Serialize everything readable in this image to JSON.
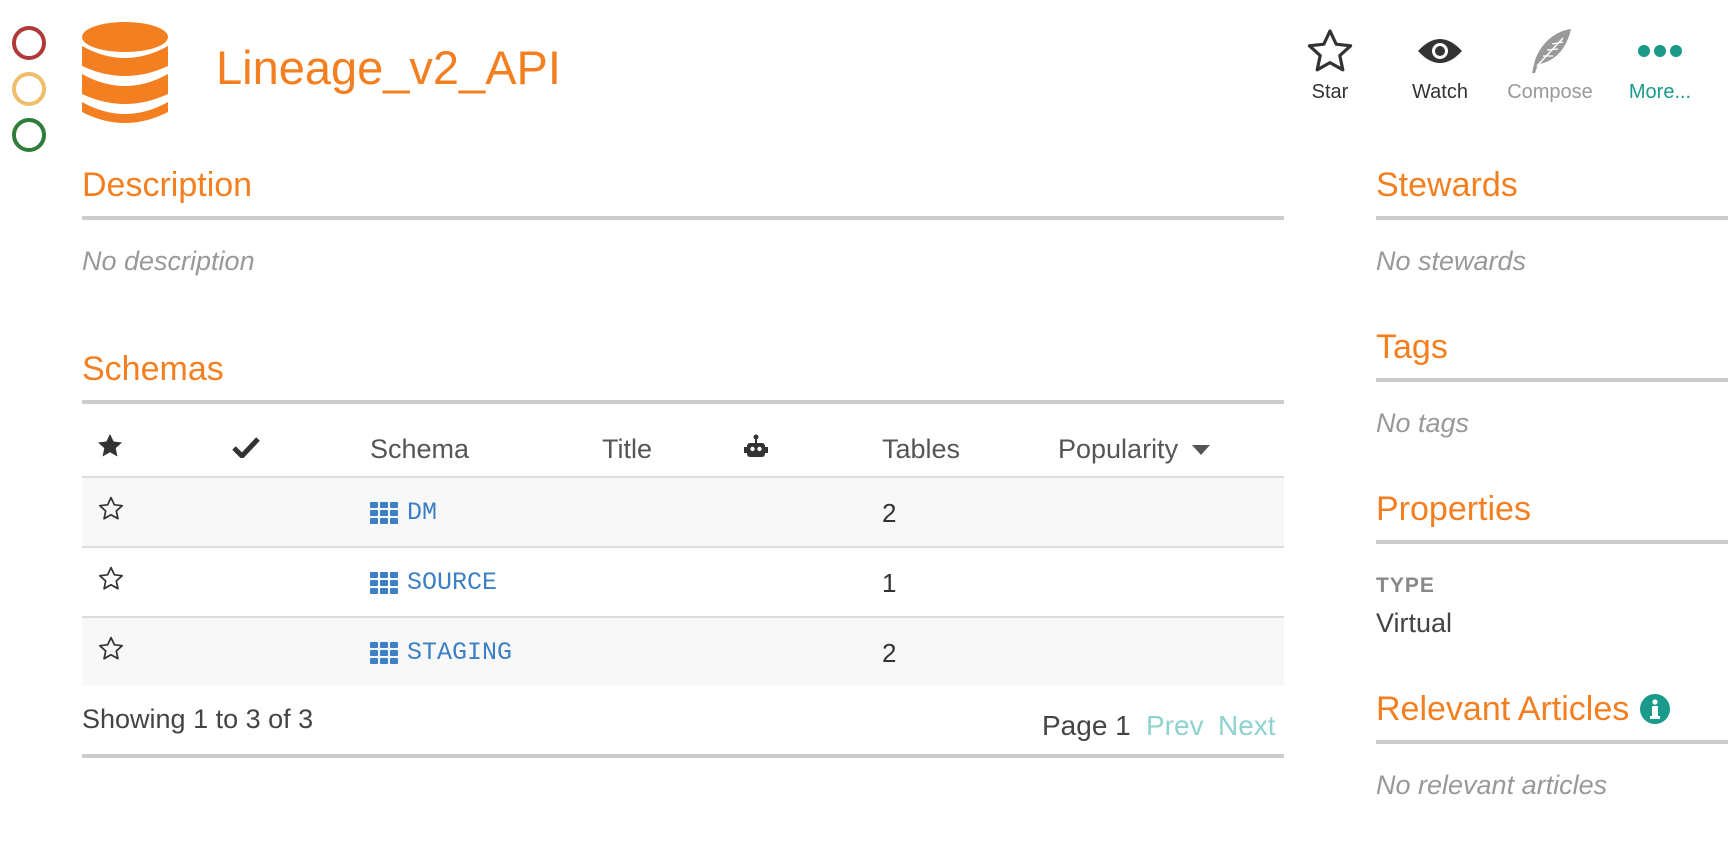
{
  "header": {
    "title": "Lineage_v2_API",
    "status_colors": [
      "#b03a3a",
      "#f0bd6b",
      "#2f7d38"
    ],
    "brand_color": "#f47f20",
    "icon": "database-icon"
  },
  "actions": [
    {
      "label": "Star",
      "icon": "star-outline-icon"
    },
    {
      "label": "Watch",
      "icon": "eye-icon"
    },
    {
      "label": "Compose",
      "icon": "feather-icon"
    },
    {
      "label": "More...",
      "icon": "ellipsis-icon"
    }
  ],
  "description": {
    "title": "Description",
    "empty": "No description"
  },
  "schemas": {
    "title": "Schemas",
    "columns": {
      "star_icon": "star-solid-icon",
      "check_icon": "check-icon",
      "schema": "Schema",
      "title": "Title",
      "bot_icon": "robot-icon",
      "tables": "Tables",
      "popularity": "Popularity"
    },
    "rows": [
      {
        "name": "DM",
        "tables": "2"
      },
      {
        "name": "SOURCE",
        "tables": "1"
      },
      {
        "name": "STAGING",
        "tables": "2"
      }
    ],
    "footer": {
      "showing": "Showing 1 to 3 of 3",
      "page": "Page 1",
      "prev": "Prev",
      "next": "Next"
    }
  },
  "sidebar": {
    "stewards": {
      "title": "Stewards",
      "empty": "No stewards"
    },
    "tags": {
      "title": "Tags",
      "empty": "No tags"
    },
    "properties": {
      "title": "Properties",
      "key": "TYPE",
      "value": "Virtual"
    },
    "articles": {
      "title": "Relevant Articles",
      "empty": "No relevant articles",
      "info_icon": "info-icon"
    }
  }
}
